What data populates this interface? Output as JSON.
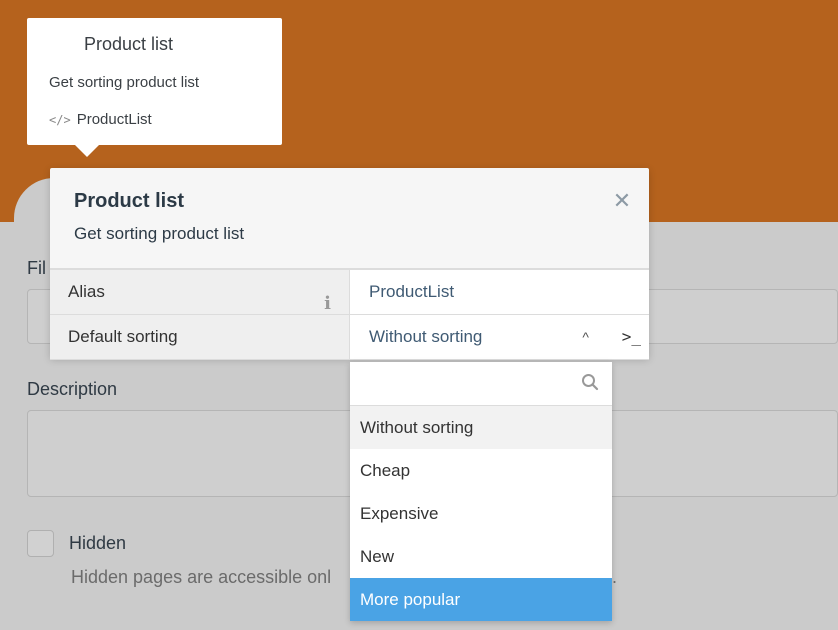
{
  "tooltip": {
    "title": "Product list",
    "subtitle": "Get sorting product list",
    "code_icon": "</>",
    "code_name": "ProductList"
  },
  "modal": {
    "title": "Product list",
    "subtitle": "Get sorting product list",
    "close_glyph": "✕",
    "rows": [
      {
        "label": "Alias",
        "value": "ProductList"
      },
      {
        "label": "Default sorting",
        "value": "Without sorting"
      }
    ],
    "info_glyph": "i",
    "chevron_glyph": "^",
    "terminal_glyph": ">_"
  },
  "dropdown": {
    "search_placeholder": "",
    "options": [
      "Without sorting",
      "Cheap",
      "Expensive",
      "New",
      "More popular"
    ],
    "hovered": "Without sorting",
    "active": "More popular"
  },
  "background_form": {
    "field_label_partial": "Fil",
    "description_label": "Description",
    "hidden_label": "Hidden",
    "hidden_note_left": "Hidden pages are accessible onl",
    "hidden_note_right": "."
  },
  "colors": {
    "header_orange": "#b5621d",
    "active_blue": "#4aa3e5"
  }
}
